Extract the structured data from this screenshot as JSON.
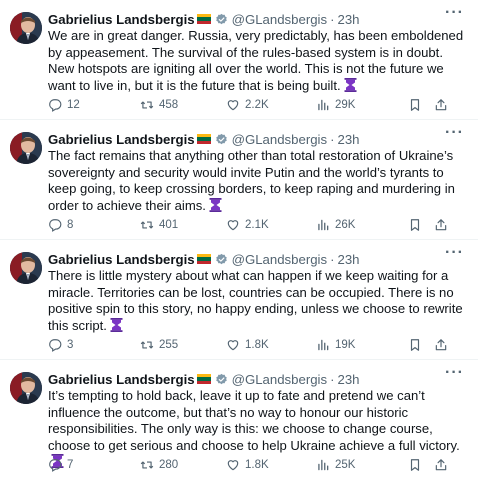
{
  "author": {
    "name": "Gabrielius Landsbergis",
    "handle": "@GLandsbergis",
    "flag_colors": [
      "#fdb913",
      "#006a44",
      "#c1272d"
    ],
    "verified_color": "#829aab"
  },
  "colors": {
    "text": "#0f1419",
    "secondary": "#536471",
    "hourglass_purple": "#7b35c4"
  },
  "icons": {
    "more": "more-icon",
    "reply": "reply-icon",
    "retweet": "retweet-icon",
    "like": "heart-icon",
    "views": "views-icon",
    "bookmark": "bookmark-icon",
    "share": "share-icon"
  },
  "tweets": [
    {
      "time": "23h",
      "text": "We are in great danger. Russia, very predictably, has been emboldened by appeasement. The survival of the rules-based system is in doubt. New hotspots are igniting all over the world. This is not the future we want to live in, but it is the future that is being built.",
      "replies": "12",
      "retweets": "458",
      "likes": "2.2K",
      "views": "29K"
    },
    {
      "time": "23h",
      "text": "The fact remains that anything other than total restoration of Ukraine’s sovereignty and security would invite Putin and the world’s tyrants to keep going, to keep crossing borders, to keep raping and murdering in order to achieve their aims.",
      "replies": "8",
      "retweets": "401",
      "likes": "2.1K",
      "views": "26K"
    },
    {
      "time": "23h",
      "text": "There is little mystery about what can happen if we keep waiting for a miracle. Territories can be lost, countries can be occupied. There is no positive spin to this story, no happy ending, unless we choose to rewrite this script.",
      "replies": "3",
      "retweets": "255",
      "likes": "1.8K",
      "views": "19K"
    },
    {
      "time": "23h",
      "text": "It’s tempting to hold back, leave it up to fate and pretend we can’t influence the outcome, but that’s no way to honour our historic responsibilities. The only way is this: we choose to change course, choose to get serious and choose to help Ukraine achieve a full victory.",
      "replies": "7",
      "retweets": "280",
      "likes": "1.8K",
      "views": "25K"
    }
  ]
}
